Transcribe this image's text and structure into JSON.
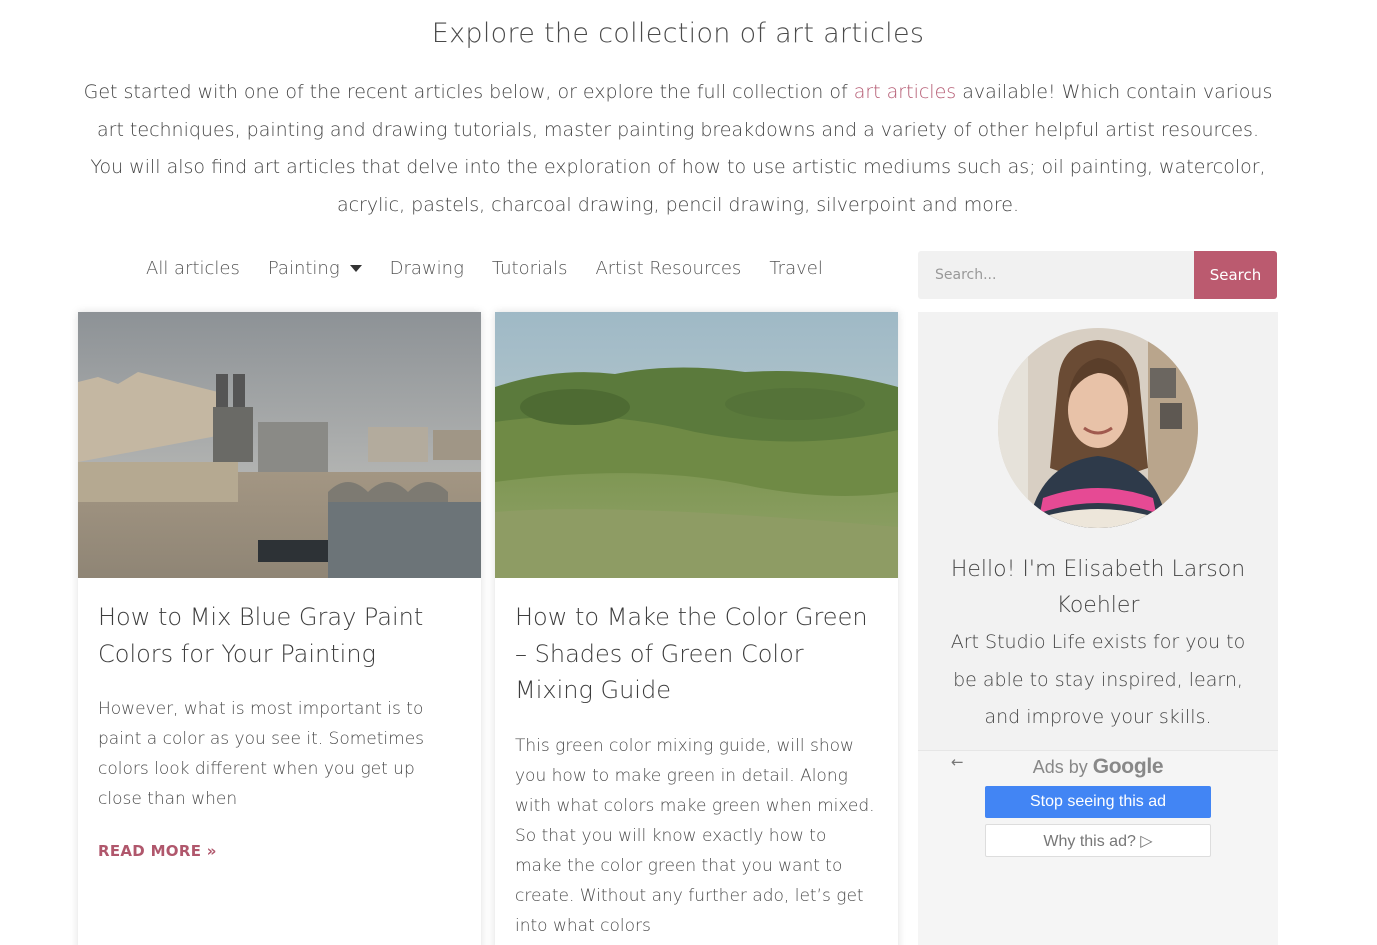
{
  "header": {
    "title": "Explore the collection of art articles",
    "intro_before": "Get started with one of the recent articles below, or explore the full collection of ",
    "intro_link": "art articles",
    "intro_after": " available! Which contain various art techniques, painting and drawing tutorials, master painting breakdowns and a variety of other helpful artist resources. You will also find art articles that delve into the exploration of how to use artistic mediums such as; oil painting, watercolor, acrylic, pastels, charcoal drawing, pencil drawing, silverpoint and more."
  },
  "nav": {
    "items": [
      "All articles",
      "Painting",
      "Drawing",
      "Tutorials",
      "Artist Resources",
      "Travel"
    ]
  },
  "search": {
    "placeholder": "Search...",
    "button": "Search"
  },
  "articles": [
    {
      "title": "How to Mix Blue Gray Paint Colors for Your Painting",
      "excerpt": "However, what is most important is to paint a color as you see it. Sometimes colors look different when you get up close than when",
      "read_more": "READ MORE »"
    },
    {
      "title": "How to Make the Color Green – Shades of Green Color Mixing Guide",
      "excerpt": "This green color mixing guide, will show you how to make green in detail. Along with what colors make green when mixed. So that you will know exactly how to make the color green that you want to create. Without any further ado, let’s get into what colors"
    }
  ],
  "sidebar": {
    "hello": "Hello! I'm Elisabeth Larson Koehler",
    "bio": "Art Studio Life exists for you to be able to stay inspired, learn, and improve your skills."
  },
  "ad": {
    "back": "←",
    "ads_by": "Ads by",
    "google": "Google",
    "stop": "Stop seeing this ad",
    "why": "Why this ad? ▷"
  },
  "colors": {
    "accent": "#bb5a6f",
    "link": "#b45a72",
    "ad_blue": "#4285f4"
  }
}
